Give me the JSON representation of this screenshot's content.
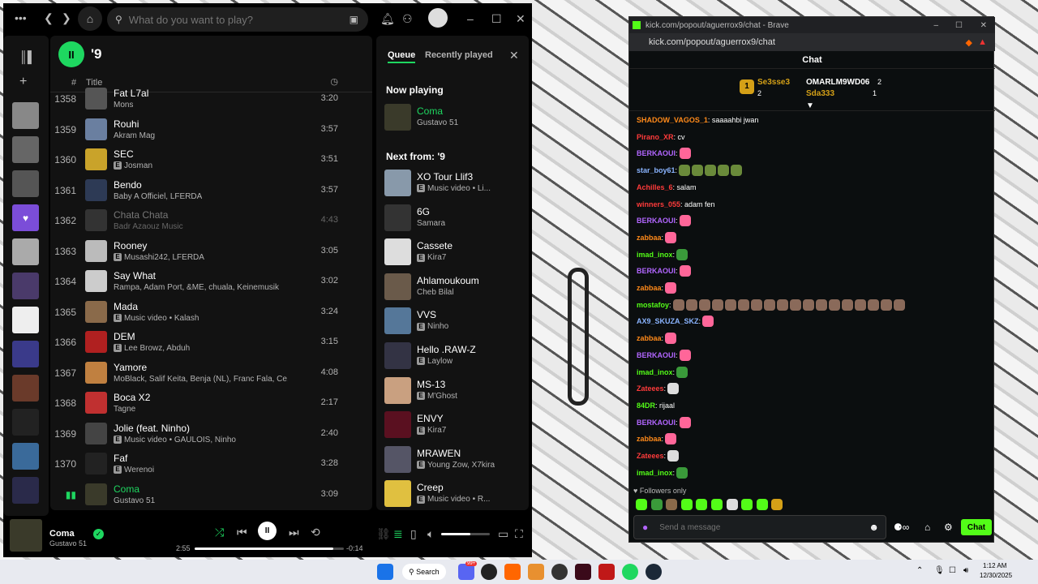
{
  "spotify": {
    "search_placeholder": "What do you want to play?",
    "playlist_title": "'9",
    "pause_glyph": "II",
    "col_num": "#",
    "col_title": "Title",
    "tracks": [
      {
        "n": "1358",
        "title": "Fat L7al",
        "artist": "Mons",
        "explicit": false,
        "dur": "3:20",
        "color": "#555"
      },
      {
        "n": "1359",
        "title": "Rouhi",
        "artist": "Akram Mag",
        "explicit": false,
        "dur": "3:57",
        "color": "#6a7fa0"
      },
      {
        "n": "1360",
        "title": "SEC",
        "artist": "Josman",
        "explicit": true,
        "dur": "3:51",
        "color": "#c9a32a"
      },
      {
        "n": "1361",
        "title": "Bendo",
        "artist": "Baby A Officiel, LFERDA",
        "explicit": false,
        "dur": "3:57",
        "color": "#2d3a55"
      },
      {
        "n": "1362",
        "title": "Chata Chata",
        "artist": "Badr Azaouz Music",
        "explicit": false,
        "dur": "4:43",
        "color": "#333"
      },
      {
        "n": "1363",
        "title": "Rooney",
        "artist": "Musashi242, LFERDA",
        "explicit": true,
        "dur": "3:05",
        "color": "#bbb"
      },
      {
        "n": "1364",
        "title": "Say What",
        "artist": "Rampa, Adam Port, &ME, chuala, Keinemusik",
        "explicit": false,
        "dur": "3:02",
        "color": "#ccc"
      },
      {
        "n": "1365",
        "title": "Mada",
        "artist": "Music video • Kalash",
        "explicit": true,
        "dur": "3:24",
        "color": "#8a6a4a"
      },
      {
        "n": "1366",
        "title": "DEM",
        "artist": "Lee Browz, Abduh",
        "explicit": true,
        "dur": "3:15",
        "color": "#b02020"
      },
      {
        "n": "1367",
        "title": "Yamore",
        "artist": "MoBlack, Salif Keita, Benja (NL), Franc Fala, Ce...",
        "explicit": false,
        "dur": "4:08",
        "color": "#c08040"
      },
      {
        "n": "1368",
        "title": "Boca X2",
        "artist": "Tagne",
        "explicit": false,
        "dur": "2:17",
        "color": "#c03030"
      },
      {
        "n": "1369",
        "title": "Jolie (feat. Ninho)",
        "artist": "Music video • GAULOIS, Ninho",
        "explicit": true,
        "dur": "2:40",
        "color": "#444"
      },
      {
        "n": "1370",
        "title": "Faf",
        "artist": "Werenoi",
        "explicit": true,
        "dur": "3:28",
        "color": "#222"
      },
      {
        "n": "",
        "title": "Coma",
        "artist": "Gustavo 51",
        "explicit": false,
        "dur": "3:09",
        "color": "#3a3a2a"
      }
    ],
    "queue": {
      "tab_queue": "Queue",
      "tab_recent": "Recently played",
      "now_playing": "Now playing",
      "np_title": "Coma",
      "np_artist": "Gustavo 51",
      "next_from": "Next from: '9",
      "items": [
        {
          "title": "XO Tour Llif3",
          "artist": "Music video • Li...",
          "explicit": true,
          "color": "#8899aa"
        },
        {
          "title": "6G",
          "artist": "Samara",
          "explicit": false,
          "color": "#333"
        },
        {
          "title": "Cassete",
          "artist": "Kira7",
          "explicit": true,
          "color": "#ddd"
        },
        {
          "title": "Ahlamoukoum",
          "artist": "Cheb Bilal",
          "explicit": false,
          "color": "#6a5a4a"
        },
        {
          "title": "VVS",
          "artist": "Ninho",
          "explicit": true,
          "color": "#557799"
        },
        {
          "title": "Hello .RAW-Z",
          "artist": "Laylow",
          "explicit": true,
          "color": "#334"
        },
        {
          "title": "MS-13",
          "artist": "M'Ghost",
          "explicit": true,
          "color": "#c9a080"
        },
        {
          "title": "ENVY",
          "artist": "Kira7",
          "explicit": true,
          "color": "#5a1020"
        },
        {
          "title": "MRAWEN",
          "artist": "Young Zow, X7kira",
          "explicit": true,
          "color": "#556"
        },
        {
          "title": "Creep",
          "artist": "Music video • R...",
          "explicit": true,
          "color": "#e0c040"
        }
      ]
    },
    "player": {
      "title": "Coma",
      "artist": "Gustavo 51",
      "elapsed": "2:55",
      "remaining": "-0:14",
      "progress": 0.93,
      "volume": 0.6
    }
  },
  "chat": {
    "window_title": "kick.com/popout/aguerrox9/chat - Brave",
    "url": "kick.com/popout/aguerrox9/chat",
    "header": "Chat",
    "leaders": [
      {
        "rank": "1",
        "name": "Se3sse3",
        "count": "2"
      },
      {
        "name": "OMARLM9WD06",
        "count": "2"
      },
      {
        "name": "Sda333",
        "count": "1"
      }
    ],
    "messages": [
      {
        "user": "SHADOW_VAGOS_1",
        "color": "#ff8a1a",
        "text": ": saaaahbi jwan",
        "emotes": 0
      },
      {
        "user": "Pirano_XR",
        "color": "#ff3b3b",
        "text": ": cv",
        "emotes": 0
      },
      {
        "user": "BERKAOUI",
        "color": "#b266ff",
        "text": ":",
        "emotes": 1,
        "ecolor": "#ff6699"
      },
      {
        "user": "star_boy61",
        "color": "#8ab4ff",
        "text": ":",
        "emotes": 5,
        "ecolor": "#6a8a3a"
      },
      {
        "user": "Achilles_6",
        "color": "#ff3b3b",
        "text": ": salam",
        "emotes": 0
      },
      {
        "user": "winners_055",
        "color": "#ff3b3b",
        "text": ": adam fen",
        "emotes": 0
      },
      {
        "user": "BERKAOUI",
        "color": "#b266ff",
        "text": ":",
        "emotes": 1,
        "ecolor": "#ff6699"
      },
      {
        "user": "zabbaa",
        "color": "#ff8a1a",
        "text": ":",
        "emotes": 1,
        "ecolor": "#ff6699"
      },
      {
        "user": "imad_inox",
        "color": "#53fc18",
        "text": ":",
        "emotes": 1,
        "ecolor": "#3a9a3a"
      },
      {
        "user": "BERKAOUI",
        "color": "#b266ff",
        "text": ":",
        "emotes": 1,
        "ecolor": "#ff6699"
      },
      {
        "user": "zabbaa",
        "color": "#ff8a1a",
        "text": ":",
        "emotes": 1,
        "ecolor": "#ff6699"
      },
      {
        "user": "mostafoy",
        "color": "#53fc18",
        "text": ":",
        "emotes": 18,
        "ecolor": "#8a6a5a"
      },
      {
        "user": "AX9_SKUZA_SKZ",
        "color": "#8ab4ff",
        "text": ":",
        "emotes": 1,
        "ecolor": "#ff6699"
      },
      {
        "user": "zabbaa",
        "color": "#ff8a1a",
        "text": ":",
        "emotes": 1,
        "ecolor": "#ff6699"
      },
      {
        "user": "BERKAOUI",
        "color": "#b266ff",
        "text": ":",
        "emotes": 1,
        "ecolor": "#ff6699"
      },
      {
        "user": "imad_inox",
        "color": "#53fc18",
        "text": ":",
        "emotes": 1,
        "ecolor": "#3a9a3a"
      },
      {
        "user": "Zateees",
        "color": "#ff3b3b",
        "text": ":",
        "emotes": 1,
        "ecolor": "#ddd"
      },
      {
        "user": "84DR",
        "color": "#53fc18",
        "text": ": rijaal",
        "emotes": 0
      },
      {
        "user": "BERKAOUI",
        "color": "#b266ff",
        "text": ":",
        "emotes": 1,
        "ecolor": "#ff6699"
      },
      {
        "user": "zabbaa",
        "color": "#ff8a1a",
        "text": ":",
        "emotes": 1,
        "ecolor": "#ff6699"
      },
      {
        "user": "Zateees",
        "color": "#ff3b3b",
        "text": ":",
        "emotes": 1,
        "ecolor": "#ddd"
      },
      {
        "user": "imad_inox",
        "color": "#53fc18",
        "text": ":",
        "emotes": 1,
        "ecolor": "#3a9a3a"
      }
    ],
    "followers_only": "Followers only",
    "input_placeholder": "Send a message",
    "send_label": "Chat"
  },
  "taskbar": {
    "search": "Search",
    "time": "1:12 AM",
    "date": "12/30/2025",
    "badge": "99+"
  },
  "colors": {
    "spotify_green": "#1ed760",
    "kick_green": "#53fc18"
  }
}
